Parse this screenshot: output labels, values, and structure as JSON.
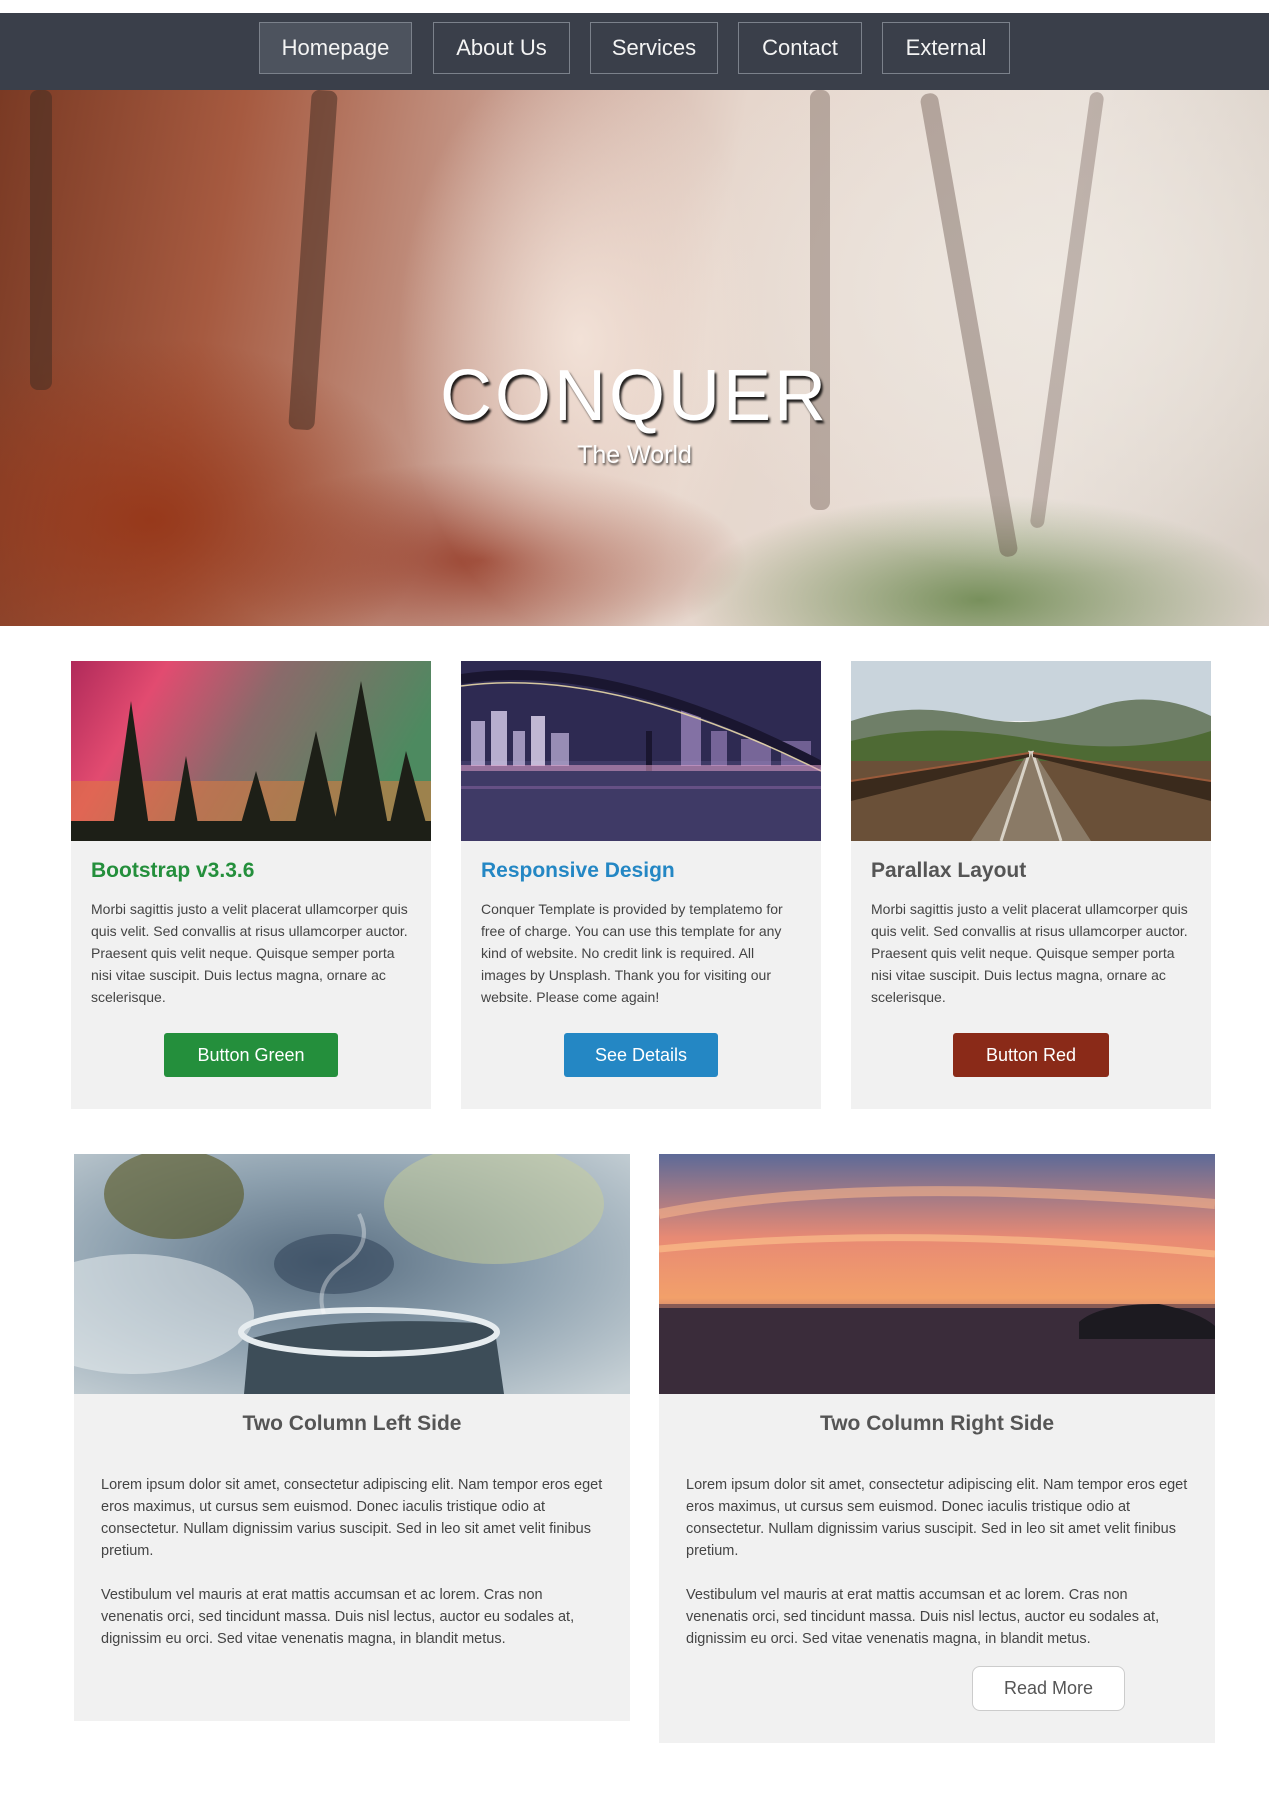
{
  "nav": {
    "items": [
      {
        "label": "Homepage",
        "active": true
      },
      {
        "label": "About Us",
        "active": false
      },
      {
        "label": "Services",
        "active": false
      },
      {
        "label": "Contact",
        "active": false
      },
      {
        "label": "External",
        "active": false
      }
    ]
  },
  "hero": {
    "title": "CONQUER",
    "subtitle": "The World"
  },
  "cards": [
    {
      "title": "Bootstrap v3.3.6",
      "title_color": "#248f3c",
      "text": "Morbi sagittis justo a velit placerat ullamcorper quis quis velit. Sed convallis at risus ullamcorper auctor. Praesent quis velit neque. Quisque semper porta nisi vitae suscipit. Duis lectus magna, ornare ac scelerisque.",
      "button": "Button Green",
      "button_color": "#248f3c"
    },
    {
      "title": "Responsive Design",
      "title_color": "#2487c4",
      "text": "Conquer Template is provided by templatemo for free of charge. You can use this template for any kind of website. No credit link is required. All images by Unsplash. Thank you for visiting our website. Please come again!",
      "button": "See Details",
      "button_color": "#2487c4"
    },
    {
      "title": "Parallax Layout",
      "title_color": "#555555",
      "text": "Morbi sagittis justo a velit placerat ullamcorper quis quis velit. Sed convallis at risus ullamcorper auctor. Praesent quis velit neque. Quisque semper porta nisi vitae suscipit. Duis lectus magna, ornare ac scelerisque.",
      "button": "Button Red",
      "button_color": "#8a2a18"
    }
  ],
  "columns": {
    "left": {
      "title": "Two Column Left Side",
      "p1": "Lorem ipsum dolor sit amet, consectetur adipiscing elit. Nam tempor eros eget eros maximus, ut cursus sem euismod. Donec iaculis tristique odio at consectetur. Nullam dignissim varius suscipit. Sed in leo sit amet velit finibus pretium.",
      "p2": "Vestibulum vel mauris at erat mattis accumsan et ac lorem. Cras non venenatis orci, sed tincidunt massa. Duis nisl lectus, auctor eu sodales at, dignissim eu orci. Sed vitae venenatis magna, in blandit metus."
    },
    "right": {
      "title": "Two Column Right Side",
      "p1": "Lorem ipsum dolor sit amet, consectetur adipiscing elit. Nam tempor eros eget eros maximus, ut cursus sem euismod. Donec iaculis tristique odio at consectetur. Nullam dignissim varius suscipit. Sed in leo sit amet velit finibus pretium.",
      "p2": "Vestibulum vel mauris at erat mattis accumsan et ac lorem. Cras non venenatis orci, sed tincidunt massa. Duis nisl lectus, auctor eu sodales at, dignissim eu orci. Sed vitae venenatis magna, in blandit metus.",
      "button": "Read More"
    }
  }
}
